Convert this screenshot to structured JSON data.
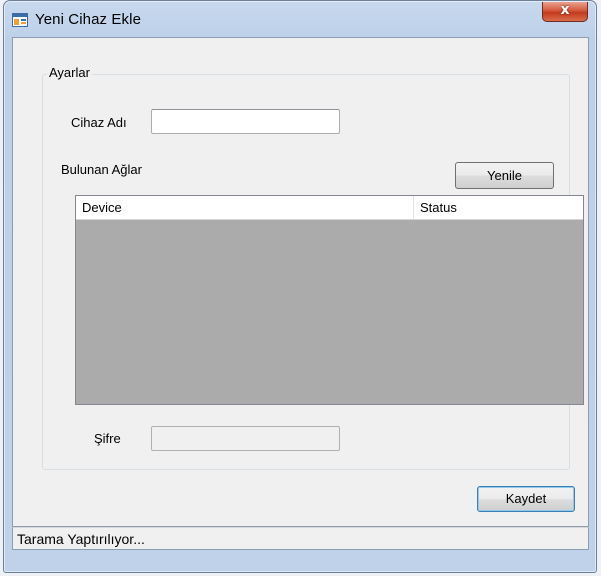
{
  "window": {
    "title": "Yeni Cihaz Ekle",
    "close_glyph": "x",
    "app_icon": "form-window-icon"
  },
  "settings_group": {
    "title": "Ayarlar",
    "device_name_label": "Cihaz Adı",
    "device_name_value": "",
    "networks_label": "Bulunan Ağlar",
    "refresh_button": "Yenile",
    "list": {
      "columns": [
        "Device",
        "Status"
      ],
      "rows": []
    },
    "password_label": "Şifre",
    "password_value": ""
  },
  "save_button": "Kaydet",
  "status_bar": {
    "text": "Tarama Yaptırılıyor..."
  },
  "colors": {
    "list_background": "#ababab",
    "close_button": "#c43a1d"
  }
}
